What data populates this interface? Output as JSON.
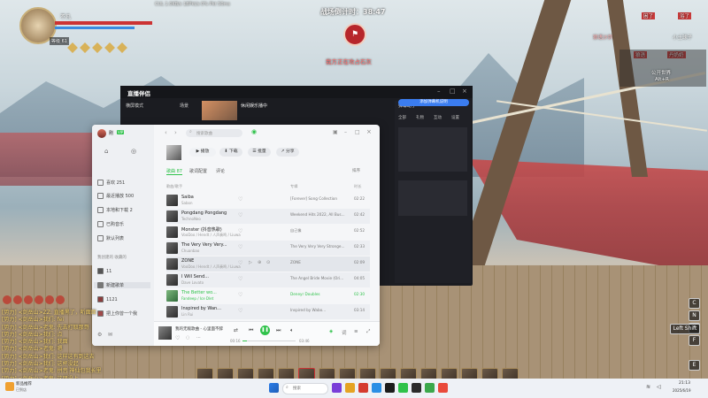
{
  "player": {
    "name": "不凡",
    "level": "等级 61"
  },
  "top_info": {
    "fps_text": "CUL 1.0KB/s  18Pkt/s  0% Pkt 50ms"
  },
  "battle": {
    "countdown": "战场倒计时：38:47",
    "guard_label": "我方正在攻占石灰"
  },
  "team_tags": [
    {
      "text": "困了",
      "color": "#c93a3a"
    },
    {
      "text": "浴了",
      "color": "#c93a3a"
    },
    {
      "text": "小土球子",
      "color": "#c93a3a"
    },
    {
      "text": "狼语沙弥",
      "color": "#c93a3a"
    },
    {
      "text": "狼语",
      "color": "#c93a3a"
    },
    {
      "text": "丹奶奶",
      "color": "#c93a3a"
    }
  ],
  "minimap": {
    "title": "公开世界",
    "shortcut": "Alt+R"
  },
  "live_window": {
    "app_title": "直播伴侣",
    "mode_label": "横屏模式",
    "tab_label": "场景",
    "scene_label": "休闲娱乐播中",
    "right_panel_title": "弹幕助手",
    "right_tabs": [
      "全部",
      "礼物",
      "互动",
      "设置"
    ],
    "notice_button": "添加弹幕机说明"
  },
  "music": {
    "user": "刚",
    "vip_badge": "VIP",
    "search_placeholder": "搜索歌曲",
    "sidebar": [
      {
        "label": "喜欢 251"
      },
      {
        "label": "最近播放 500"
      },
      {
        "label": "本地和下载 2"
      },
      {
        "label": "已购音乐"
      },
      {
        "label": "默认列表"
      }
    ],
    "sidebar_section": "我创建的  收藏的",
    "playlists": [
      {
        "label": "11"
      },
      {
        "label": "新建歌单"
      },
      {
        "label": "1121"
      },
      {
        "label": "把上你曾一个我"
      }
    ],
    "actions": {
      "play": "播放",
      "download": "下载",
      "batch": "批量",
      "share": "分享"
    },
    "tabs": [
      "歌曲 87",
      "歌词配置",
      "评论"
    ],
    "sort_label": "排序",
    "columns": {
      "title": "歌曲/歌手",
      "album": "专辑",
      "duration": "时长"
    },
    "songs": [
      {
        "title": "Saiba",
        "artist": "Sabon",
        "album": "[Forever] Song Collection",
        "duration": "02:22"
      },
      {
        "title": "Pongdang Pongdang",
        "artist": "TechnoNeo",
        "album": "Weekend Hits 2022, All Bus...",
        "duration": "02:42"
      },
      {
        "title": "Monster (抖音热歌)",
        "artist": "VooDoo / Hendt / 人声奏鸣 / Liuwa",
        "album": "自己像",
        "duration": "02:52"
      },
      {
        "title": "The Very Very Very...",
        "artist": "Chuanbao",
        "album": "The Very Very Very Stronge...",
        "duration": "02:33"
      },
      {
        "title": "ZONE",
        "artist": "VooDoo / Hendt / 人声奏鸣 / Liuwa",
        "album": "ZONE",
        "duration": "02:09"
      },
      {
        "title": "I Will Send...",
        "artist": "Dave Lovato",
        "album": "The Angel Bride Movie (Ori...",
        "duration": "04:05"
      },
      {
        "title": "The Better wo...",
        "artist": "Fandeep / Ice Dlet",
        "album": "Deneyr Doubles",
        "duration": "02:30"
      },
      {
        "title": "Inspired by Wan...",
        "artist": "Lin Rui",
        "album": "Inspired by Wabo...",
        "duration": "03:14"
      }
    ],
    "now_playing": {
      "title": "我的无敌歌曲 - 心里面不醉",
      "elapsed": "00:16",
      "total": "03:46"
    }
  },
  "chat": [
    "[势力] <剑岳山>ZZ: 直播黑了，听面面",
    "[势力] <剑岳山>我们: fei",
    "[势力] <剑岳山>老鬼: 先去打取那哥",
    "[势力] <剑岳山>我们: 点",
    "[势力] <剑岳山>我们: 我面",
    "[势力] <剑岳山>老鬼: 嗯",
    "[势力] <剑岳山>我们: 这样这有到这去",
    "[势力] <剑岳山>我们: 这杯没起",
    "[势力] <剑岳山>老鬼: 拼音 神仙包我长里",
    "[势力] <剑岳山>老鬼: 这朋没上"
  ],
  "keys": [
    "C",
    "N",
    "X",
    "Left Shift",
    "F",
    "E"
  ],
  "taskbar": {
    "weather": "新品推荐",
    "weather_sub": "已到店",
    "search_placeholder": "搜索",
    "time": "21:13",
    "date": "2025/6/19"
  },
  "colors": {
    "accent_green": "#2fc24a",
    "team_red": "#c93a3a",
    "chat_yellow": "#f6d36a"
  }
}
